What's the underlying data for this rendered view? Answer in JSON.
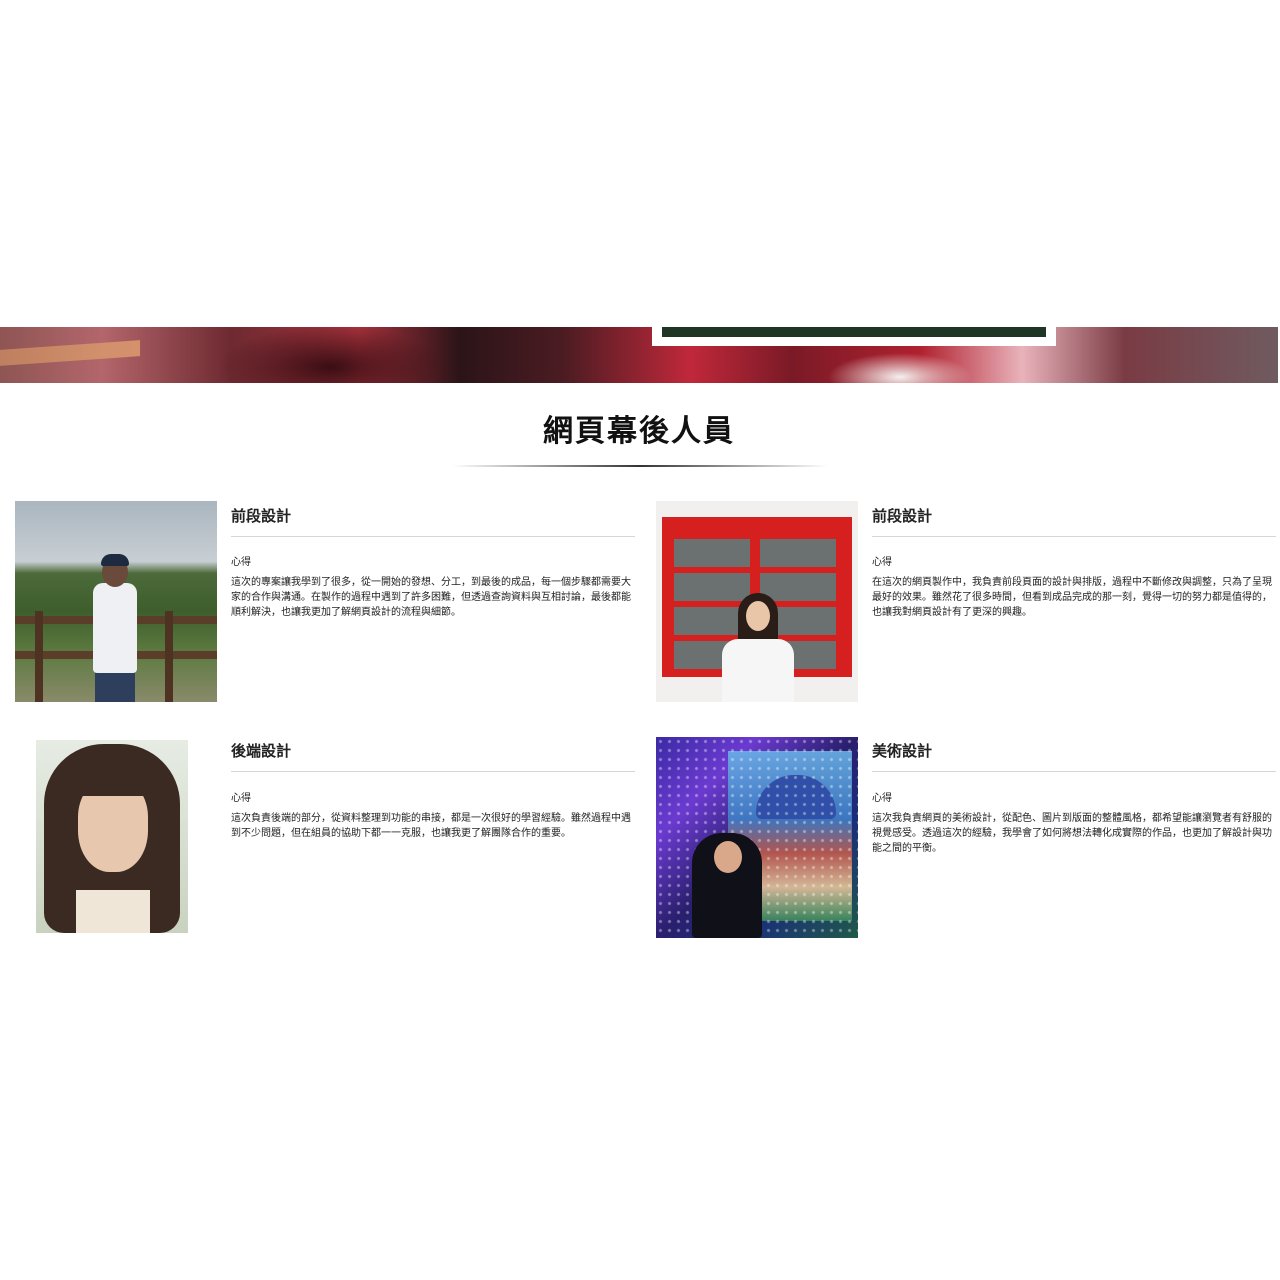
{
  "section": {
    "title": "網頁幕後人員"
  },
  "members": [
    {
      "role": "前段設計",
      "note_label": "心得",
      "note": "這次的專案讓我學到了很多，從一開始的發想、分工，到最後的成品，每一個步驟都需要大家的合作與溝通。在製作的過程中遇到了許多困難，但透過查詢資料與互相討論，最後都能順利解決，也讓我更加了解網頁設計的流程與細節。"
    },
    {
      "role": "前段設計",
      "note_label": "心得",
      "note": "在這次的網頁製作中，我負責前段頁面的設計與排版，過程中不斷修改與調整，只為了呈現最好的效果。雖然花了很多時間，但看到成品完成的那一刻，覺得一切的努力都是值得的，也讓我對網頁設計有了更深的興趣。"
    },
    {
      "role": "後端設計",
      "note_label": "心得",
      "note": "這次負責後端的部分，從資料整理到功能的串接，都是一次很好的學習經驗。雖然過程中遇到不少問題，但在組員的協助下都一一克服，也讓我更了解團隊合作的重要。"
    },
    {
      "role": "美術設計",
      "note_label": "心得",
      "note": "這次我負責網頁的美術設計，從配色、圖片到版面的整體風格，都希望能讓瀏覽者有舒服的視覺感受。透過這次的經驗，我學會了如何將想法轉化成實際的作品，也更加了解設計與功能之間的平衡。"
    }
  ]
}
